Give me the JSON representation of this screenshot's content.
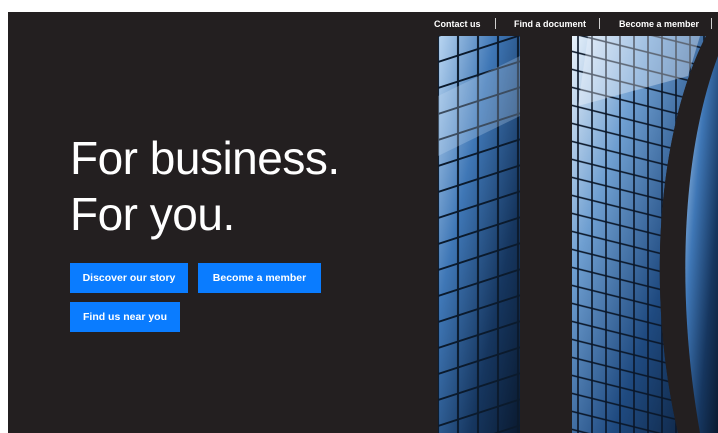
{
  "topnav": {
    "links": [
      {
        "label": "Contact us"
      },
      {
        "label": "Find a document"
      },
      {
        "label": "Become a member"
      }
    ]
  },
  "hero": {
    "title_line1": "For business.",
    "title_line2": "For you.",
    "buttons": {
      "discover": "Discover our story",
      "become_member": "Become a member",
      "find_us": "Find us near you"
    }
  },
  "colors": {
    "background": "#231f20",
    "accent": "#0a7cff",
    "text": "#ffffff"
  }
}
